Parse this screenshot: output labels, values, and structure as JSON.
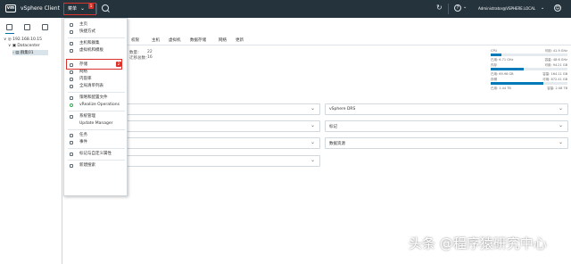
{
  "header": {
    "logo": "vm",
    "app_title": "vSphere Client",
    "menu_label": "菜单",
    "badge1": "1",
    "user": "Administrator@VSPHERE.LOCAL",
    "help_glyph": "?",
    "refresh_glyph": "↻",
    "smile_glyph": "☺",
    "colors": {
      "header_bg": "#25333d",
      "highlight": "#d9342b",
      "accent": "#0079b8"
    }
  },
  "navigator": {
    "tree": [
      {
        "label": "192.168.10.15"
      },
      {
        "label": "Datacenter"
      },
      {
        "label": "群集01"
      }
    ]
  },
  "menu": {
    "items": [
      {
        "label": "主页",
        "icon": "home-icon"
      },
      {
        "label": "快捷方式",
        "icon": "shortcuts-icon"
      },
      {
        "label": "主机和群集",
        "icon": "hosts-clusters-icon"
      },
      {
        "label": "虚拟机和模板",
        "icon": "vms-templates-icon"
      },
      {
        "label": "存储",
        "icon": "storage-icon"
      },
      {
        "label": "网络",
        "icon": "network-icon"
      },
      {
        "label": "内容库",
        "icon": "content-library-icon"
      },
      {
        "label": "全局清单列表",
        "icon": "inventory-list-icon"
      },
      {
        "label": "策略和配置文件",
        "icon": "policies-icon"
      },
      {
        "label": "vRealize Operations",
        "icon": "vrealize-icon"
      },
      {
        "label": "系统管理",
        "icon": "administration-icon"
      },
      {
        "label": "Update Manager",
        "icon": "update-manager-icon"
      },
      {
        "label": "任务",
        "icon": "tasks-icon"
      },
      {
        "label": "事件",
        "icon": "events-icon"
      },
      {
        "label": "标记与自定义属性",
        "icon": "tags-icon"
      },
      {
        "label": "新建搜索",
        "icon": "search-icon"
      }
    ],
    "badge2": "2"
  },
  "main": {
    "tabs": [
      "权限",
      "主机",
      "虚拟机",
      "数据存储",
      "网络",
      "更新"
    ],
    "stats": [
      {
        "label": "数量：",
        "value": "22"
      },
      {
        "label": "迁移总数：",
        "value": "16"
      }
    ],
    "resources": [
      {
        "label": "CPU",
        "free": "可用: 41.9 GHz",
        "used": "已用: 6.71 GHz",
        "capacity": "容量: 48.6 GHz",
        "fill": 0.14
      },
      {
        "label": "内存",
        "free": "可用: 94.21 GB",
        "used": "已用: 69.98 GB",
        "capacity": "容量: 164.11 GB",
        "fill": 0.43
      },
      {
        "label": "存储",
        "free": "可用: 672.41 GB",
        "used": "已用: 1.44 TB",
        "capacity": "容量: 2.08 TB",
        "fill": 0.69
      }
    ],
    "panels": [
      {
        "title": "",
        "right": false
      },
      {
        "title": "vSphere DRS",
        "right": true
      },
      {
        "title": "",
        "right": false
      },
      {
        "title": "标记",
        "right": true
      },
      {
        "title": "",
        "right": false
      },
      {
        "title": "数据资源",
        "right": true
      },
      {
        "title": "",
        "right": false
      }
    ]
  },
  "watermark": "头条 @程序猿研究中心"
}
